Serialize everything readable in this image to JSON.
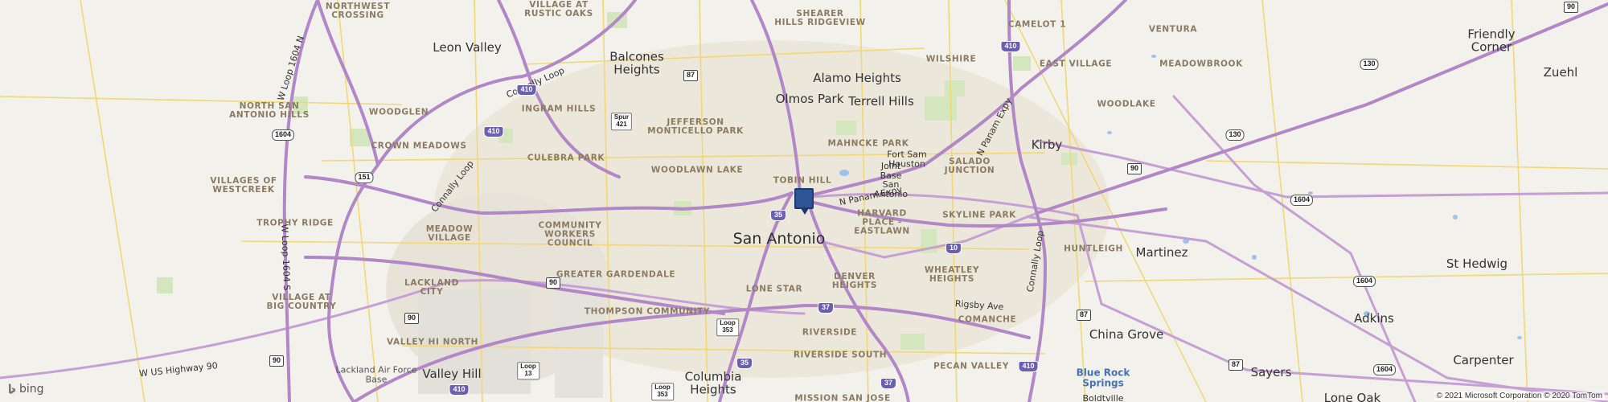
{
  "map": {
    "center_city": "San Antonio",
    "labels": {
      "northwest_crossing": "NORTHWEST\nCROSSING",
      "leon_valley": "Leon Valley",
      "village_rustic_oaks": "VILLAGE AT\nRUSTIC OAKS",
      "balcones_heights": "Balcones\nHeights",
      "shearer_hills": "SHEARER\nHILLS RIDGEVIEW",
      "camelot": "CAMELOT 1",
      "ventura": "VENTURA",
      "friendly_corner": "Friendly\nCorner",
      "zuehl": "Zuehl",
      "alamo_heights": "Alamo Heights",
      "wilshire": "WILSHIRE",
      "east_village": "EAST VILLAGE",
      "meadowbrook": "MEADOWBROOK",
      "olmos_park": "Olmos Park",
      "terrell_hills": "Terrell Hills",
      "woodlake": "WOODLAKE",
      "north_sa_hills": "NORTH SAN\nANTONIO HILLS",
      "woodglen": "WOODGLEN",
      "ingram_hills": "INGRAM HILLS",
      "jefferson_monticello": "JEFFERSON\nMONTICELLO PARK",
      "mahncke_park": "MAHNCKE PARK",
      "fort_sam": "Fort Sam\nHouston",
      "joint_base": "Joint\nBase\nSan\nAntonio",
      "kirby": "Kirby",
      "crown_meadows": "CROWN MEADOWS",
      "culebra_park": "CULEBRA PARK",
      "salado_junction": "SALADO\nJUNCTION",
      "woodlawn_lake": "WOODLAWN LAKE",
      "tobin_hill": "TOBIN HILL",
      "villages_westcreek": "VILLAGES OF\nWESTCREEK",
      "n_panam": "N Panam Expy",
      "trophy_ridge": "TROPHY RIDGE",
      "harvard_place": "HARVARD\nPLACE -\nEASTLAWN",
      "skyline_park": "SKYLINE PARK",
      "meadow_village": "MEADOW\nVILLAGE",
      "community_workers": "COMMUNITY\nWORKERS\nCOUNCIL",
      "huntleigh": "HUNTLEIGH",
      "martinez": "Martinez",
      "st_hedwig": "St Hedwig",
      "greater_gardendale": "GREATER GARDENDALE",
      "wheatley_heights": "WHEATLEY\nHEIGHTS",
      "lackland": "LACKLAND\nCITY",
      "denver_heights": "DENVER\nHEIGHTS",
      "lone_star": "LONE STAR",
      "village_big_country": "VILLAGE AT\nBIG COUNTRY",
      "thompson": "THOMPSON COMMUNITY",
      "rigsby": "Rigsby Ave",
      "comanche": "COMANCHE",
      "china_grove": "China Grove",
      "adkins": "Adkins",
      "valley_hi_north": "VALLEY HI NORTH",
      "riverside": "RIVERSIDE",
      "riverside_south": "RIVERSIDE SOUTH",
      "lackland_afb": "Lackland Air Force\nBase",
      "valley_hill": "Valley Hill",
      "columbia_heights": "Columbia\nHeights",
      "pecan_valley": "PECAN VALLEY",
      "blue_rock": "Blue Rock\nSprings",
      "sayers": "Sayers",
      "carpenter": "Carpenter",
      "w_us_hwy_90": "W US Highway 90",
      "connally_loop_nw": "Connally Loop",
      "connally_loop_w": "Connally Loop",
      "connally_loop_e": "Connally Loop",
      "n_panam_e": "N Panam Expy",
      "w_loop_1604_n": "W Loop 1604 N",
      "w_loop_1604_s": "W Loop 1604 S",
      "mission_san_jose": "MISSION SAN JOSE",
      "boldtville": "Boldtville",
      "lone_oak": "Lone Oak"
    },
    "shields": [
      {
        "id": "i410_n",
        "type": "int",
        "text": "410"
      },
      {
        "id": "i410_nw",
        "type": "int",
        "text": "410"
      },
      {
        "id": "i410_w",
        "type": "int",
        "text": "410"
      },
      {
        "id": "i410_sw",
        "type": "int",
        "text": "410"
      },
      {
        "id": "i410_se",
        "type": "int",
        "text": "410"
      },
      {
        "id": "i35_c",
        "type": "int",
        "text": "35"
      },
      {
        "id": "i35_s",
        "type": "int",
        "text": "35"
      },
      {
        "id": "i37",
        "type": "int",
        "text": "37"
      },
      {
        "id": "i37_s",
        "type": "int",
        "text": "37"
      },
      {
        "id": "i10",
        "type": "int",
        "text": "10"
      },
      {
        "id": "us87_n",
        "type": "us",
        "text": "87"
      },
      {
        "id": "us87_e",
        "type": "us",
        "text": "87"
      },
      {
        "id": "us87_se",
        "type": "us",
        "text": "87"
      },
      {
        "id": "us90_c",
        "type": "us",
        "text": "90"
      },
      {
        "id": "us90_w",
        "type": "us",
        "text": "90"
      },
      {
        "id": "us90_sw",
        "type": "us",
        "text": "90"
      },
      {
        "id": "us90_e",
        "type": "us",
        "text": "90"
      },
      {
        "id": "us90_ne",
        "type": "us",
        "text": "90"
      },
      {
        "id": "s1604_nw",
        "type": "state",
        "text": "1604"
      },
      {
        "id": "s1604_e",
        "type": "state",
        "text": "1604"
      },
      {
        "id": "s1604_e2",
        "type": "state",
        "text": "1604"
      },
      {
        "id": "s1604_se",
        "type": "state",
        "text": "1604"
      },
      {
        "id": "s151",
        "type": "state",
        "text": "151"
      },
      {
        "id": "s130_n",
        "type": "state",
        "text": "130"
      },
      {
        "id": "s130_c",
        "type": "state",
        "text": "130"
      },
      {
        "id": "spur421",
        "type": "loop",
        "text": "Spur\n421"
      },
      {
        "id": "loop353",
        "type": "loop",
        "text": "Loop\n353"
      },
      {
        "id": "loop353_s",
        "type": "loop",
        "text": "Loop\n353"
      },
      {
        "id": "loop13",
        "type": "loop",
        "text": "Loop\n13"
      }
    ]
  },
  "branding": {
    "logo_text": "bing"
  },
  "attribution": "© 2021 Microsoft Corporation © 2020 TomTom",
  "colors": {
    "background": "#f3f1ec",
    "interstate": "#b287c8",
    "highway": "#c6a0d4",
    "arterial": "#f1d874",
    "marker": "#2e5596",
    "park": "#d3e6be",
    "water": "#9ec3ea"
  }
}
